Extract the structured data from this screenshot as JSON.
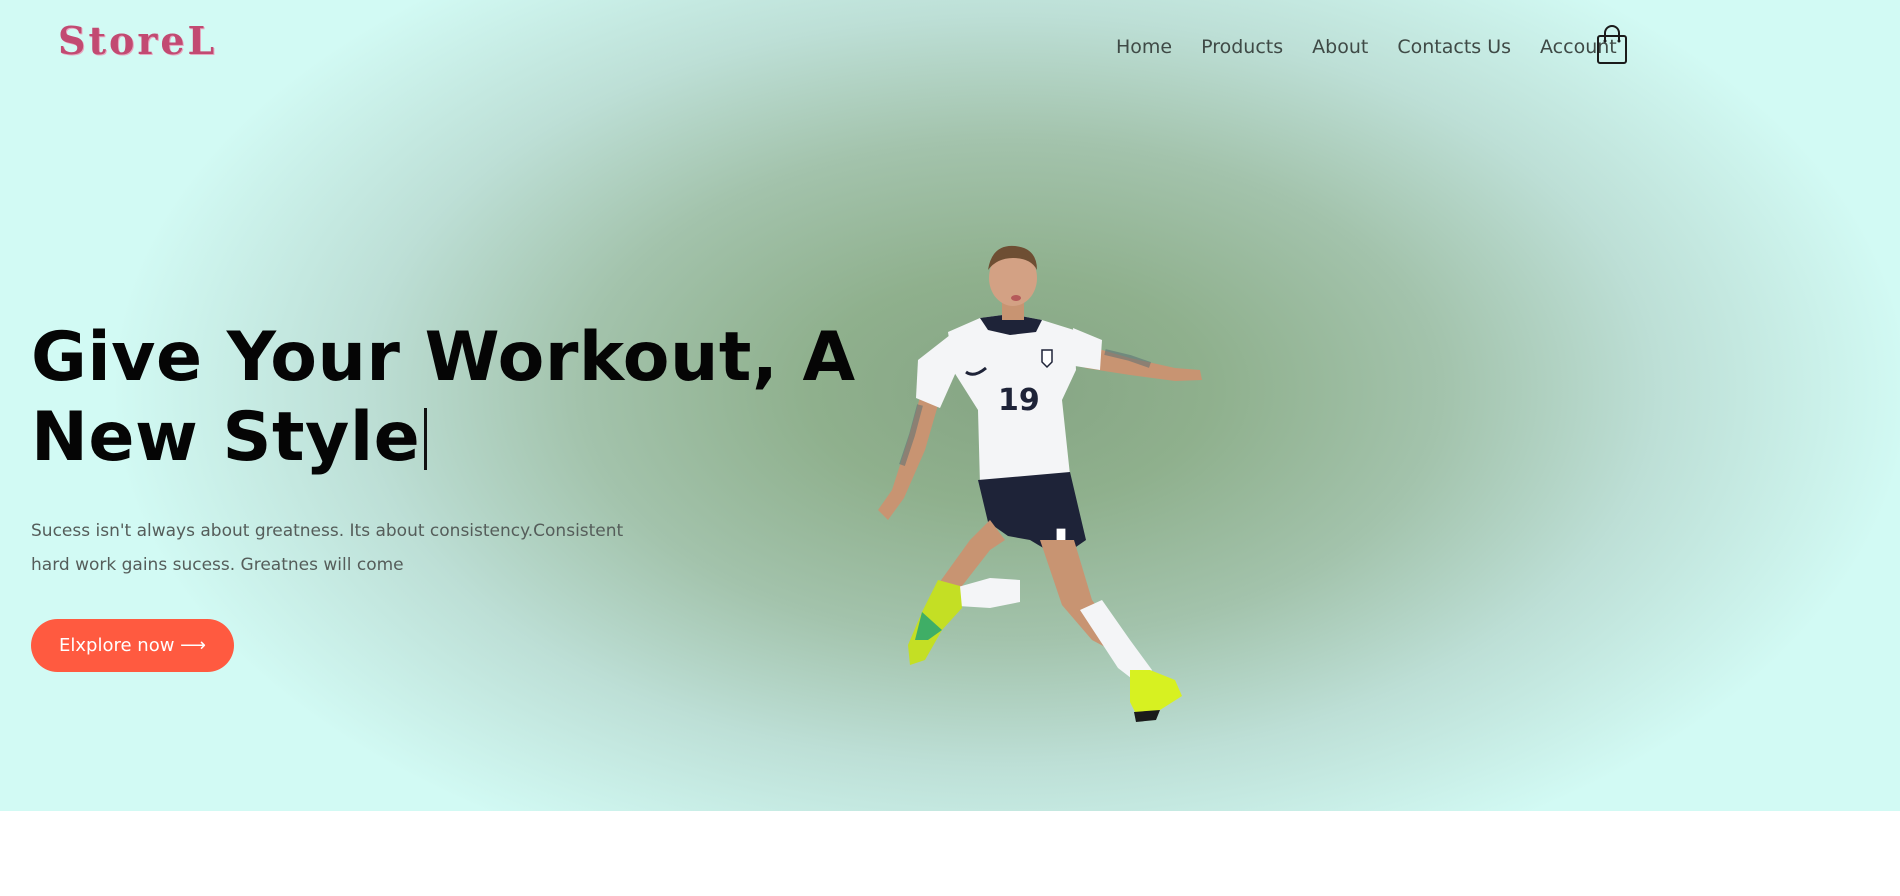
{
  "brand": {
    "logo_text": "StoreL"
  },
  "nav": {
    "items": [
      {
        "label": "Home"
      },
      {
        "label": "Products"
      },
      {
        "label": "About"
      },
      {
        "label": "Contacts Us"
      },
      {
        "label": "Account"
      }
    ],
    "cart_icon": "shopping-bag-icon"
  },
  "hero": {
    "headline_line1": "Give Your Workout, A",
    "headline_line2": "New Style",
    "description_line1": "Sucess isn't always about greatness. Its about consistency.Consistent",
    "description_line2": "hard work gains sucess. Greatnes will come",
    "cta_label": "Elxplore now ⟶",
    "image": "football-player-image"
  },
  "colors": {
    "accent": "#ff5a40",
    "logo": "#c24a72",
    "hero_center": "#86a584",
    "hero_edge": "#d2faf4"
  }
}
